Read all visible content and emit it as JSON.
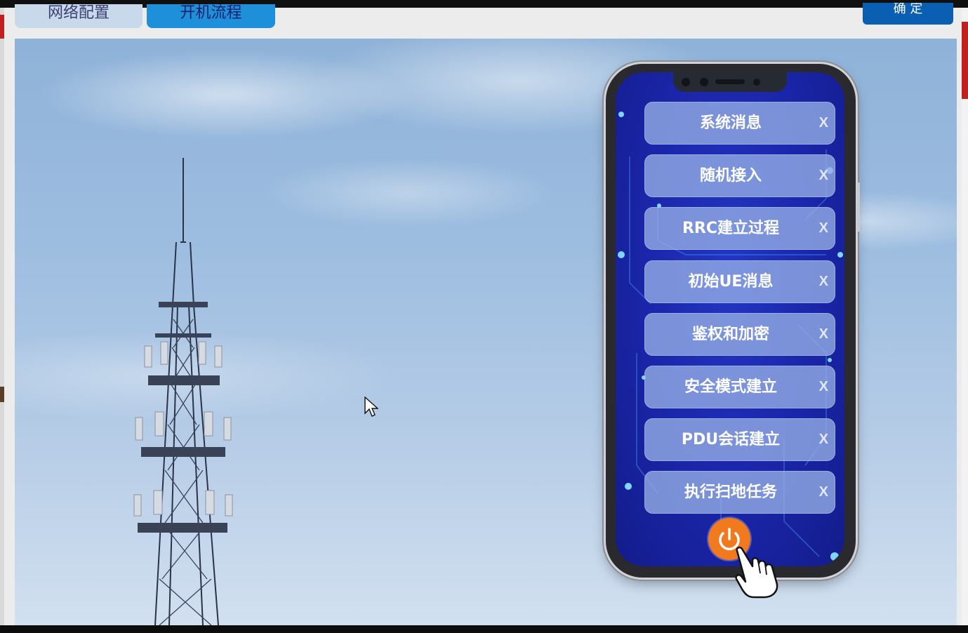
{
  "tabs": {
    "network_config": "网络配置",
    "boot_flow": "开机流程"
  },
  "confirm_label": "确 定",
  "messages": [
    {
      "label": "系统消息",
      "close": "X"
    },
    {
      "label": "随机接入",
      "close": "X"
    },
    {
      "label": "RRC建立过程",
      "close": "X"
    },
    {
      "label": "初始UE消息",
      "close": "X"
    },
    {
      "label": "鉴权和加密",
      "close": "X"
    },
    {
      "label": "安全模式建立",
      "close": "X"
    },
    {
      "label": "PDU会话建立",
      "close": "X"
    },
    {
      "label": "执行扫地任务",
      "close": "X"
    }
  ],
  "icons": {
    "power": "power-icon",
    "hand": "hand-pointer-icon",
    "cursor": "mouse-cursor-icon"
  },
  "colors": {
    "screen_blue": "#1a25a8",
    "button_fill": "#96afe6",
    "power_orange": "#f17a1f",
    "tab_active": "#1e8fd9",
    "confirm_blue": "#0b5fb3"
  }
}
